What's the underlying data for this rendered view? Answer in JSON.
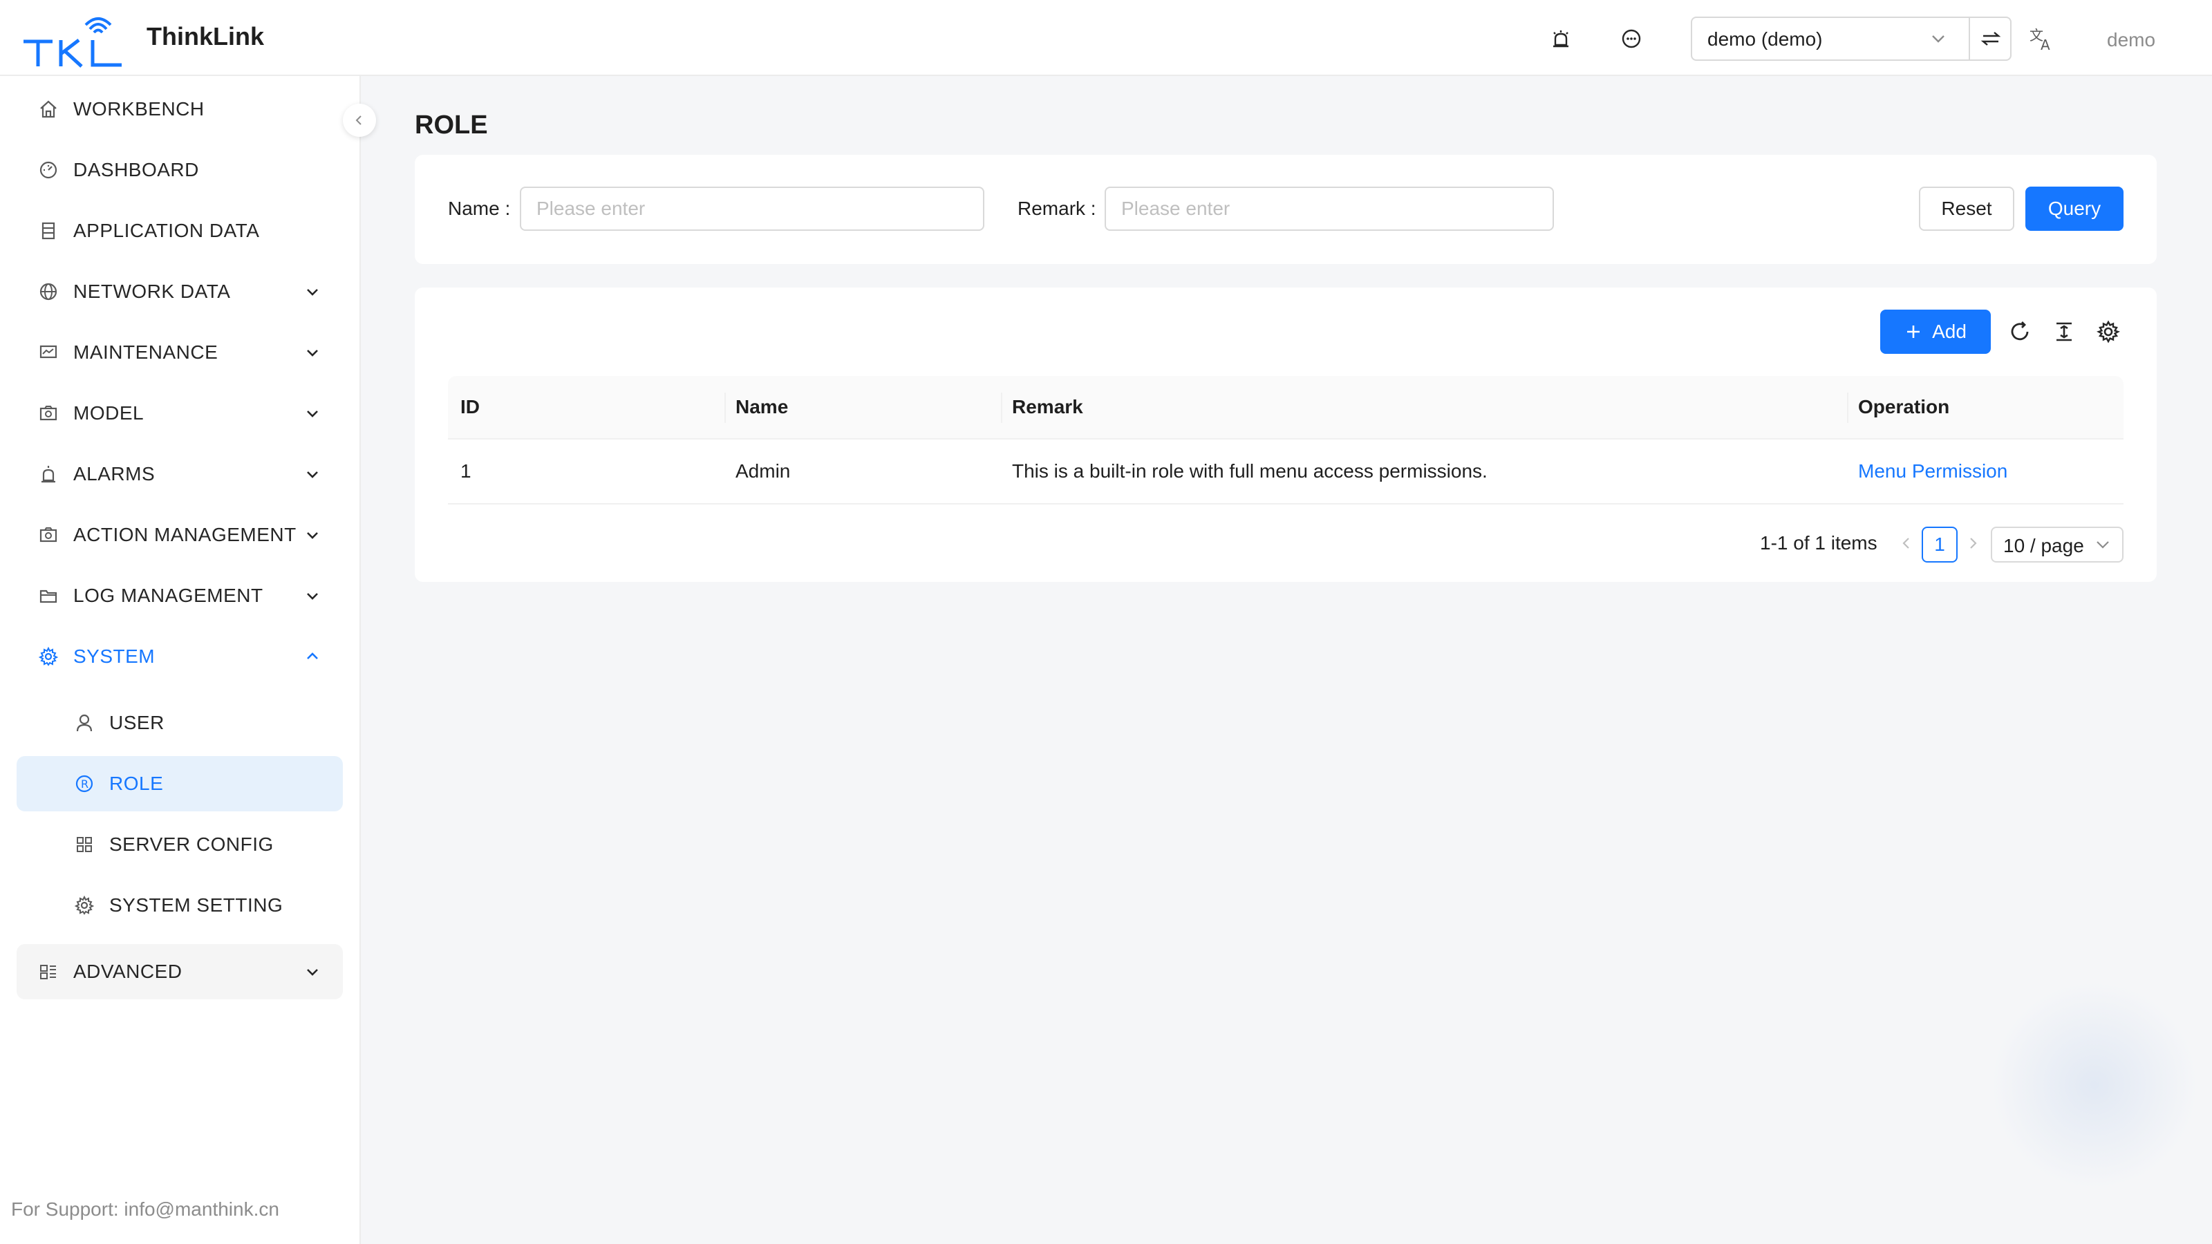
{
  "header": {
    "logo_text": "TKL",
    "app_name": "ThinkLink",
    "tenant_value": "demo (demo)",
    "user_name": "demo"
  },
  "sidebar": {
    "items": [
      {
        "label": "WORKBENCH",
        "icon": "home-icon"
      },
      {
        "label": "DASHBOARD",
        "icon": "dashboard-icon"
      },
      {
        "label": "APPLICATION DATA",
        "icon": "database-icon"
      },
      {
        "label": "NETWORK DATA",
        "icon": "globe-icon"
      },
      {
        "label": "MAINTENANCE",
        "icon": "monitor-icon"
      },
      {
        "label": "MODEL",
        "icon": "camera-icon"
      },
      {
        "label": "ALARMS",
        "icon": "alarm-icon"
      },
      {
        "label": "ACTION MANAGEMENT",
        "icon": "camera-icon"
      },
      {
        "label": "LOG MANAGEMENT",
        "icon": "folder-icon"
      },
      {
        "label": "SYSTEM",
        "icon": "gear-icon"
      },
      {
        "label": "USER",
        "icon": "user-icon"
      },
      {
        "label": "ROLE",
        "icon": "role-icon"
      },
      {
        "label": "SERVER CONFIG",
        "icon": "grid-icon"
      },
      {
        "label": "SYSTEM SETTING",
        "icon": "gear-icon"
      },
      {
        "label": "ADVANCED",
        "icon": "apps-icon"
      }
    ],
    "support": "For Support: info@manthink.cn"
  },
  "main": {
    "title": "ROLE",
    "search": {
      "name_label": "Name",
      "name_placeholder": "Please enter",
      "remark_label": "Remark",
      "remark_placeholder": "Please enter",
      "reset_label": "Reset",
      "query_label": "Query"
    },
    "toolbar": {
      "add_label": "Add"
    },
    "table": {
      "columns": [
        "ID",
        "Name",
        "Remark",
        "Operation"
      ],
      "rows": [
        {
          "id": "1",
          "name": "Admin",
          "remark": "This is a built-in role with full menu access permissions.",
          "operation": "Menu Permission"
        }
      ]
    },
    "pagination": {
      "total_text": "1-1 of 1 items",
      "current_page": "1",
      "page_size": "10 / page"
    }
  },
  "colors": {
    "primary": "#1677ff",
    "active_bg": "#e6f1fc"
  }
}
